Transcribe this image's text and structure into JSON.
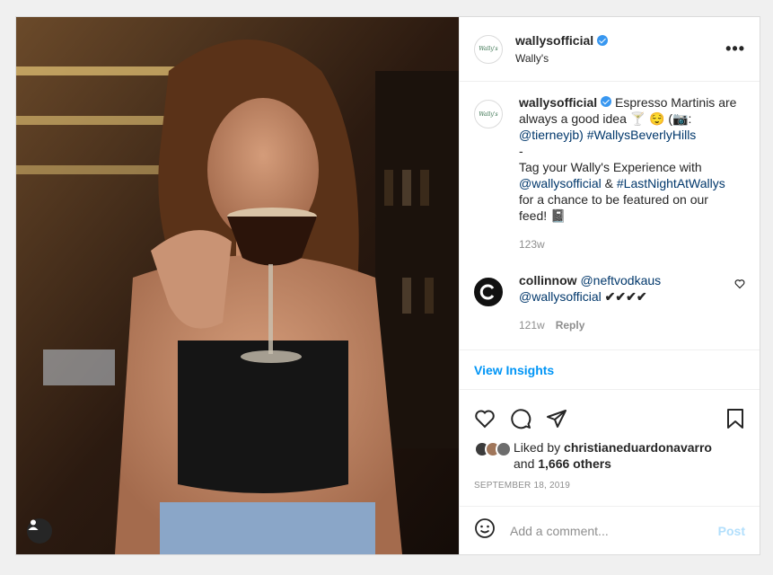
{
  "account": {
    "username": "wallysofficial",
    "display_name": "Wally's",
    "avatar_text": "Wally's"
  },
  "caption": {
    "username": "wallysofficial",
    "line1": "Espresso Martinis are always a good idea 🍸 😌 (📷:",
    "mention": "@tierneyjb)",
    "hashtag": "#WallysBeverlyHills",
    "dash": "-",
    "line2": "Tag your Wally's Experience with",
    "mention2": "@wallysofficial",
    "amp": "&",
    "hashtag2": "#LastNightAtWallys",
    "line3": "for a chance to be featured on our feed! 📓",
    "time": "123w"
  },
  "reply": {
    "username": "collinnow",
    "mention": "@neftvodkaus",
    "mention2": "@wallysofficial",
    "checks": "✔✔✔✔",
    "time": "121w",
    "reply_label": "Reply"
  },
  "insights_label": "View Insights",
  "likes": {
    "prefix": "Liked by",
    "user": "christianeduardonavarro",
    "and": "and",
    "count": "1,666 others"
  },
  "date": "SEPTEMBER 18, 2019",
  "comment_box": {
    "placeholder": "Add a comment...",
    "post_label": "Post"
  },
  "icons": [
    "more-options-icon",
    "heart-icon",
    "comment-icon",
    "share-icon",
    "save-icon",
    "emoji-icon",
    "user-tag-icon",
    "verified-badge-icon"
  ],
  "colors": {
    "link": "#00376b",
    "accent": "#0095f6",
    "verified": "#3897f0",
    "post_disabled": "#b2dffc"
  }
}
